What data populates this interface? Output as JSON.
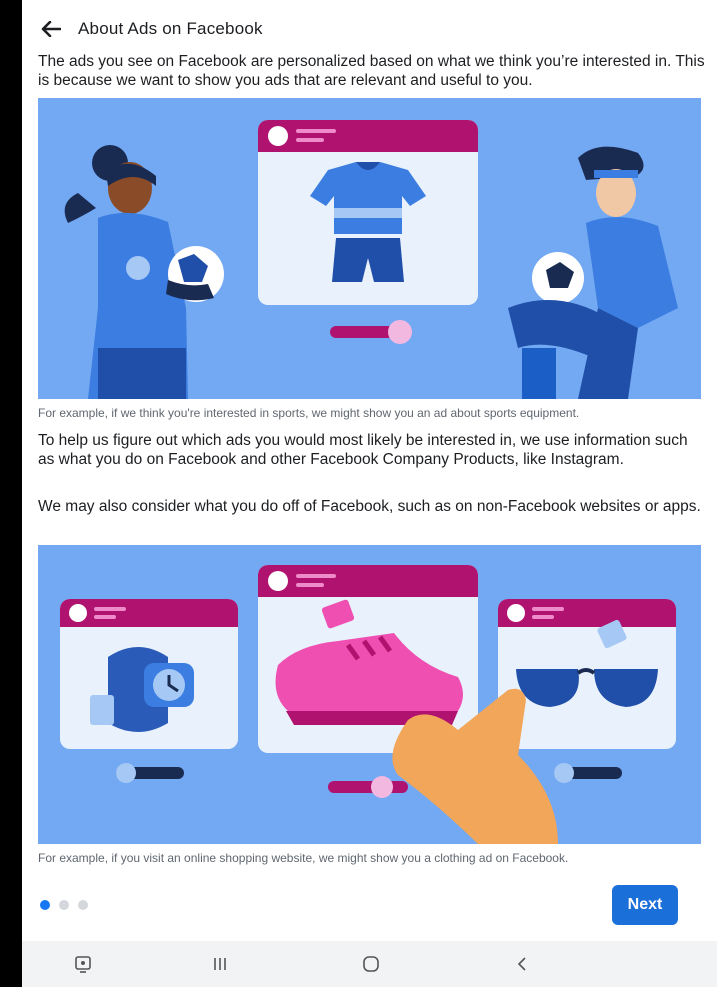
{
  "header": {
    "title": "About Ads on Facebook",
    "back_icon": "arrow-left-icon"
  },
  "intro_text": "The ads you see on Facebook are personalized based on what we think you’re interested in. This is because we want to show you ads that are relevant and useful to you.",
  "caption_1": "For example, if we think you're interested in sports, we might show you an ad about sports equipment.",
  "body_text_1": "To help us figure out which ads you would most likely be interested in, we use information such as what you do on Facebook and other Facebook Company Products, like Instagram.",
  "body_text_2": "We may also consider what you do off of Facebook, such as on non-Facebook websites or apps.",
  "caption_2": "For example, if you visit an online shopping website, we might show you a clothing ad on Facebook.",
  "pagination": {
    "total": 3,
    "active_index": 0
  },
  "footer": {
    "next_label": "Next"
  },
  "system_nav": {
    "screenshot_icon": "screenshot-icon",
    "recents_icon": "recents-icon",
    "home_icon": "home-icon",
    "back_icon": "back-icon"
  },
  "colors": {
    "illustration_bg": "#73a8f2",
    "card_header": "#b0136f",
    "accent_blue": "#1b6fd8",
    "shirt_blue": "#3b7de0",
    "shoe_pink": "#ee4fb1"
  }
}
